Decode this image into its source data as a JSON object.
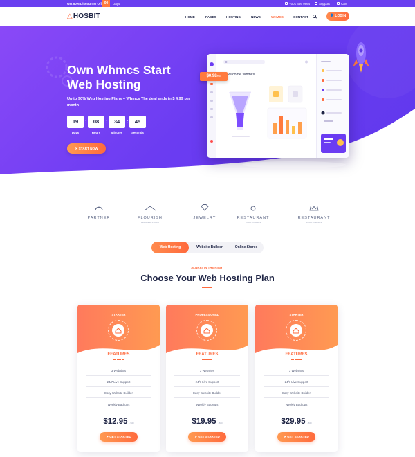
{
  "topbar": {
    "offer": "Get 50% Discounts! Offer",
    "days_count": "00",
    "days_label": "Days",
    "phone": "+001 456 9864",
    "support": "Support",
    "cart": "Cart"
  },
  "nav": {
    "logo": "HOSBIT",
    "items": [
      "HOME",
      "PAGES",
      "HOSTING",
      "NEWS",
      "WHMCS",
      "CONTACT"
    ],
    "active_item": "WHMCS",
    "login": "LOGIN"
  },
  "hero": {
    "title": "Own Whmcs Start Web Hosting",
    "subtitle": "Up to 90% Web Hosting Plans + Whmcs The deal ends in $ 4.99 per month",
    "countdown": [
      {
        "value": "19",
        "label": "Days"
      },
      {
        "value": "08",
        "label": "Hours"
      },
      {
        "value": "34",
        "label": "Minutes"
      },
      {
        "value": "45",
        "label": "Seconds"
      }
    ],
    "cta": "START NOW",
    "dashboard": {
      "price": "$0.98",
      "price_unit": "/mo",
      "welcome": "Welcome Whmcs"
    }
  },
  "brands": [
    {
      "name": "PARTNER",
      "sub": ""
    },
    {
      "name": "FLOURISH",
      "sub": "BRANDING STUDIO"
    },
    {
      "name": "JEWELRY",
      "sub": ""
    },
    {
      "name": "RESTAURANT",
      "sub": "FOOD & DRINKS"
    },
    {
      "name": "RESTAURANT",
      "sub": "FOOD & DRINKS"
    }
  ],
  "tabs": {
    "items": [
      "Web Hosting",
      "Website Builder",
      "Online Stores"
    ],
    "active": "Web Hosting"
  },
  "plans_section": {
    "eyebrow": "ALWAYS IN THE RIGHT",
    "title": "Choose Your Web Hosting Plan"
  },
  "plans": [
    {
      "name": "STARTER",
      "features_title": "FEATURES",
      "features": [
        "3 Websites",
        "24/7 Live Support",
        "Easy Website Builder",
        "Weekly Backups"
      ],
      "price": "$12.95",
      "period": "/Mo",
      "cta": "GET STARTED"
    },
    {
      "name": "PROFESSIONAL",
      "features_title": "FEATURES",
      "features": [
        "3 Websites",
        "24/7 Live Support",
        "Easy Website Builder",
        "Weekly Backups"
      ],
      "price": "$19.95",
      "period": "/Mo",
      "cta": "GET STARTED"
    },
    {
      "name": "STARTER",
      "features_title": "FEATURES",
      "features": [
        "3 Websites",
        "24/7 Live Support",
        "Easy Website Builder",
        "Weekly Backups"
      ],
      "price": "$29.95",
      "period": "/Mo",
      "cta": "GET STARTED"
    }
  ],
  "colors": {
    "hero_purple": "#6b3cf2",
    "accent_orange": "#ff6a3d",
    "dark_navy": "#1f2545"
  }
}
